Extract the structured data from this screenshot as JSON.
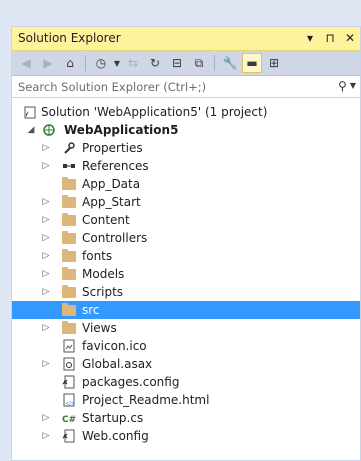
{
  "window": {
    "title": "Solution Explorer",
    "controls": [
      "▾",
      "⊓",
      "✕"
    ]
  },
  "toolbar": {
    "buttons": [
      {
        "name": "back-icon",
        "glyph": "◀"
      },
      {
        "name": "forward-icon",
        "glyph": "▶"
      },
      {
        "name": "home-icon",
        "glyph": "⌂"
      },
      {
        "name": "history-icon",
        "glyph": "◷"
      },
      {
        "name": "sync-icon",
        "glyph": "⇆"
      },
      {
        "name": "refresh-icon",
        "glyph": "↻"
      },
      {
        "name": "collapse-all-icon",
        "glyph": "⊟"
      },
      {
        "name": "copy-icon",
        "glyph": "⧉"
      },
      {
        "name": "properties-icon",
        "glyph": "🔧"
      },
      {
        "name": "pin-icon",
        "glyph": "▬"
      },
      {
        "name": "diagram-icon",
        "glyph": "⊞"
      }
    ]
  },
  "search": {
    "placeholder": "Search Solution Explorer (Ctrl+;)"
  },
  "tree": {
    "solution_label": "Solution 'WebApplication5' (1 project)",
    "project_label": "WebApplication5",
    "items": [
      {
        "label": "Properties",
        "icon": "wrench-icon",
        "expander": "▷"
      },
      {
        "label": "References",
        "icon": "references-icon",
        "expander": "▷"
      },
      {
        "label": "App_Data",
        "icon": "folder-icon",
        "expander": ""
      },
      {
        "label": "App_Start",
        "icon": "folder-icon",
        "expander": "▷"
      },
      {
        "label": "Content",
        "icon": "folder-icon",
        "expander": "▷"
      },
      {
        "label": "Controllers",
        "icon": "folder-icon",
        "expander": "▷"
      },
      {
        "label": "fonts",
        "icon": "folder-icon",
        "expander": "▷"
      },
      {
        "label": "Models",
        "icon": "folder-icon",
        "expander": "▷"
      },
      {
        "label": "Scripts",
        "icon": "folder-icon",
        "expander": "▷"
      },
      {
        "label": "src",
        "icon": "folder-icon",
        "expander": "",
        "selected": true
      },
      {
        "label": "Views",
        "icon": "folder-icon",
        "expander": "▷"
      },
      {
        "label": "favicon.ico",
        "icon": "image-file-icon",
        "expander": ""
      },
      {
        "label": "Global.asax",
        "icon": "gear-file-icon",
        "expander": "▷"
      },
      {
        "label": "packages.config",
        "icon": "config-file-icon",
        "expander": ""
      },
      {
        "label": "Project_Readme.html",
        "icon": "html-file-icon",
        "expander": ""
      },
      {
        "label": "Startup.cs",
        "icon": "csharp-file-icon",
        "expander": "▷"
      },
      {
        "label": "Web.config",
        "icon": "config-file-icon",
        "expander": "▷"
      }
    ]
  },
  "colors": {
    "selection": "#3399ff",
    "title_bar": "#fff29d",
    "folder": "#dcb67a"
  }
}
